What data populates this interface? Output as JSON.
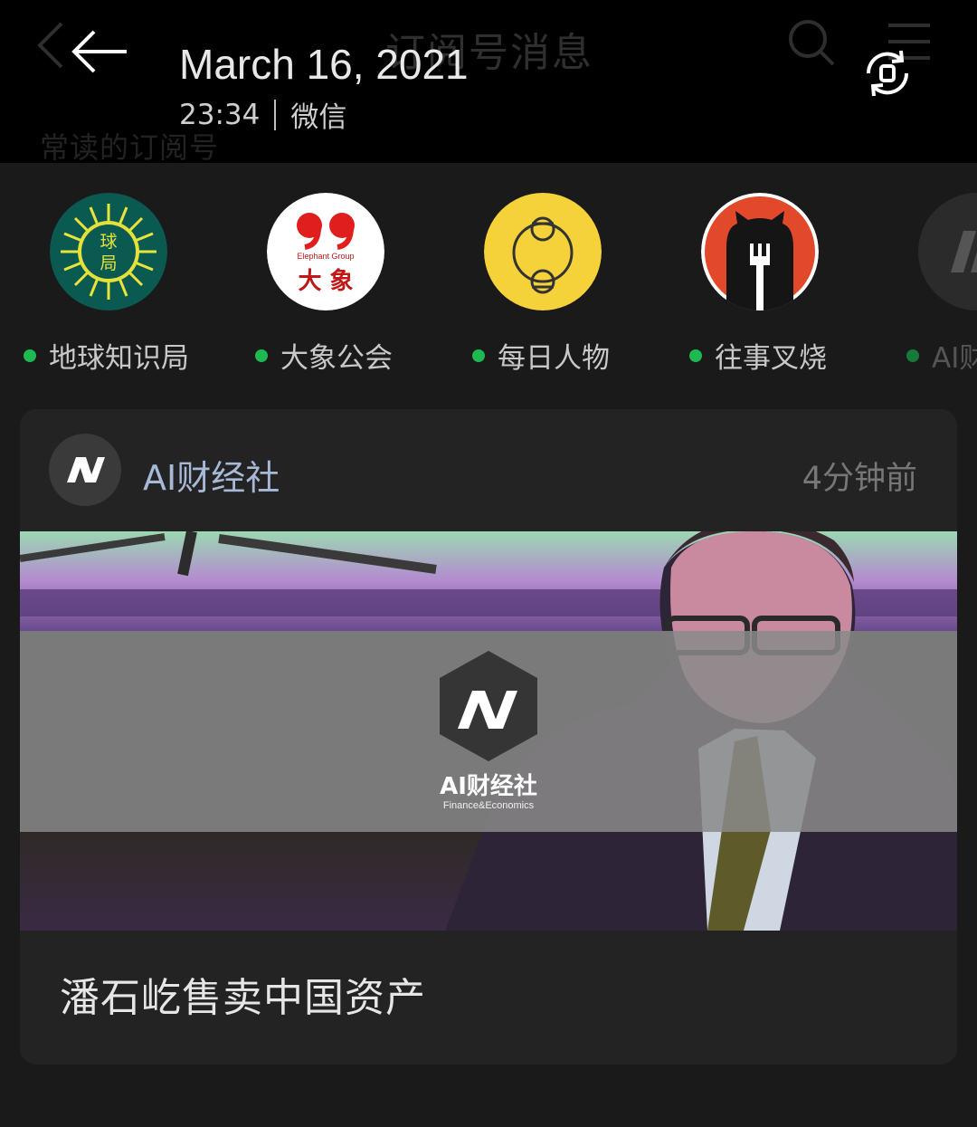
{
  "header": {
    "ghost_title": "订阅号消息",
    "ghost_section": "常读的订阅号",
    "date": "March 16, 2021",
    "time": "23:34",
    "source": "微信"
  },
  "subscriptions": [
    {
      "name": "地球知识局",
      "avatar_text": [
        "球",
        "局"
      ]
    },
    {
      "name": "大象公会",
      "avatar_text": [
        "Elephant Group",
        "大 象"
      ]
    },
    {
      "name": "每日人物",
      "avatar_text": []
    },
    {
      "name": "往事叉烧",
      "avatar_text": []
    },
    {
      "name": "AI财",
      "avatar_text": []
    }
  ],
  "article": {
    "account": "AI财经社",
    "time_ago": "4分钟前",
    "headline": "潘石屹售卖中国资产",
    "cover_logo_text": "AI财经社",
    "cover_logo_sub": "Finance&Economics"
  },
  "colors": {
    "online_dot": "#1fb954",
    "account_name": "#a7b9d6"
  }
}
